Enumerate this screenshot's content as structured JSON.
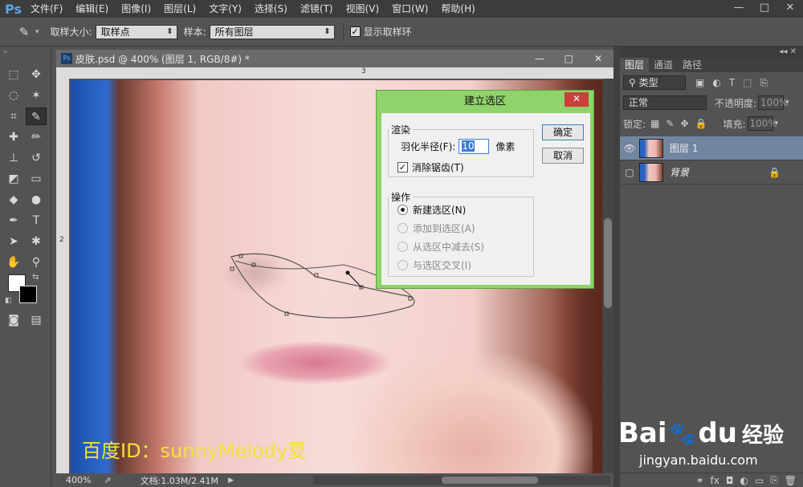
{
  "menubar": {
    "logo": "Ps",
    "items": [
      "文件(F)",
      "编辑(E)",
      "图像(I)",
      "图层(L)",
      "文字(Y)",
      "选择(S)",
      "滤镜(T)",
      "视图(V)",
      "窗口(W)",
      "帮助(H)"
    ],
    "window_controls": [
      "—",
      "□",
      "✕"
    ]
  },
  "options": {
    "sample_size_label": "取样大小:",
    "sample_size_value": "取样点",
    "sample_label": "样本:",
    "sample_value": "所有图层",
    "show_ring_label": "显示取样环",
    "show_ring_checked": true
  },
  "document": {
    "tab_title": "皮肤.psd @ 400% (图层 1, RGB/8#) *",
    "ruler_top_mark": "3",
    "ruler_left_mark": "2",
    "watermark": "百度ID：sunnyMelody夏",
    "zoom": "400%",
    "doc_info": "文档:1.03M/2.41M"
  },
  "dialog": {
    "title": "建立选区",
    "close": "✕",
    "render_legend": "渲染",
    "feather_label": "羽化半径(F):",
    "feather_value": "10",
    "feather_unit": "像素",
    "antialias_label": "消除锯齿(T)",
    "antialias_checked": true,
    "operation_legend": "操作",
    "operations": [
      {
        "label": "新建选区(N)",
        "selected": true,
        "enabled": true
      },
      {
        "label": "添加到选区(A)",
        "selected": false,
        "enabled": false
      },
      {
        "label": "从选区中减去(S)",
        "selected": false,
        "enabled": false
      },
      {
        "label": "与选区交叉(I)",
        "selected": false,
        "enabled": false
      }
    ],
    "ok": "确定",
    "cancel": "取消"
  },
  "layers_panel": {
    "tabs": [
      "图层",
      "通道",
      "路径"
    ],
    "filter_value": "类型",
    "blend_mode": "正常",
    "opacity_label": "不透明度:",
    "opacity_value": "100%",
    "lock_label": "锁定:",
    "fill_label": "填充:",
    "fill_value": "100%",
    "layers": [
      {
        "name": "图层 1",
        "visible": true,
        "selected": true
      },
      {
        "name": "背景",
        "visible": false,
        "selected": false,
        "locked": true
      }
    ]
  },
  "branding": {
    "baidu_text": "Bai",
    "baidu_du": "du",
    "jingyan": "经验",
    "url": "jingyan.baidu.com"
  }
}
